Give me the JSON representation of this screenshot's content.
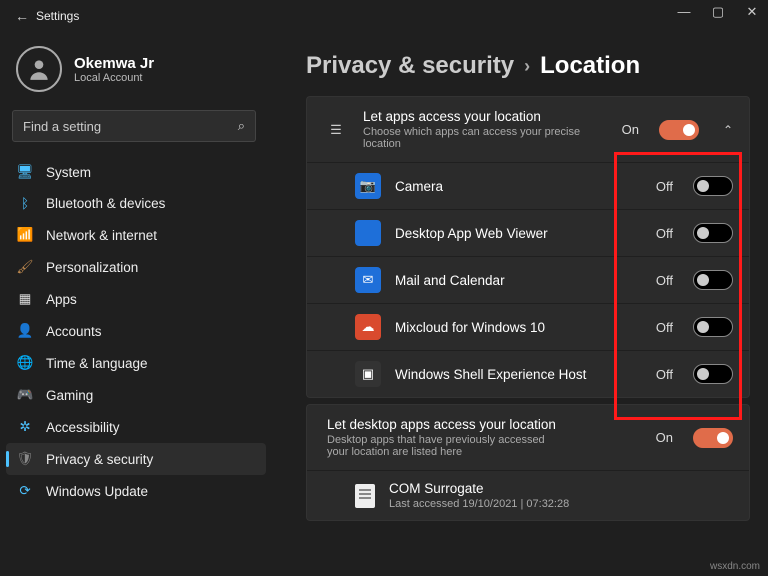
{
  "window": {
    "app_title": "Settings"
  },
  "profile": {
    "name": "Okemwa Jr",
    "account_type": "Local Account"
  },
  "search": {
    "placeholder": "Find a setting"
  },
  "nav": {
    "items": [
      {
        "label": "System",
        "icon_name": "system-icon",
        "color": "#4cc2ff",
        "glyph": "🖥"
      },
      {
        "label": "Bluetooth & devices",
        "icon_name": "bluetooth-icon",
        "color": "#4cc2ff",
        "glyph": "ᛒ"
      },
      {
        "label": "Network & internet",
        "icon_name": "network-icon",
        "color": "#4cc2ff",
        "glyph": "📶"
      },
      {
        "label": "Personalization",
        "icon_name": "personalization-icon",
        "color": "#c08a4f",
        "glyph": "🖌"
      },
      {
        "label": "Apps",
        "icon_name": "apps-icon",
        "color": "#ddd",
        "glyph": "▦"
      },
      {
        "label": "Accounts",
        "icon_name": "accounts-icon",
        "color": "#ddd",
        "glyph": "👤"
      },
      {
        "label": "Time & language",
        "icon_name": "time-icon",
        "color": "#4cc2ff",
        "glyph": "🌐"
      },
      {
        "label": "Gaming",
        "icon_name": "gaming-icon",
        "color": "#7fd06f",
        "glyph": "🎮"
      },
      {
        "label": "Accessibility",
        "icon_name": "accessibility-icon",
        "color": "#4cc2ff",
        "glyph": "✲"
      },
      {
        "label": "Privacy & security",
        "icon_name": "privacy-icon",
        "color": "#888",
        "glyph": "🛡",
        "selected": true
      },
      {
        "label": "Windows Update",
        "icon_name": "update-icon",
        "color": "#4cc2ff",
        "glyph": "⟳"
      }
    ]
  },
  "breadcrumb": {
    "parent": "Privacy & security",
    "current": "Location"
  },
  "master_toggle": {
    "title": "Let apps access your location",
    "subtitle": "Choose which apps can access your precise location",
    "state_label": "On",
    "on": true
  },
  "app_perms": [
    {
      "label": "Camera",
      "state_label": "Off",
      "on": false,
      "icon_bg": "#1e6fd9",
      "icon_name": "camera-app-icon",
      "glyph": "📷"
    },
    {
      "label": "Desktop App Web Viewer",
      "state_label": "Off",
      "on": false,
      "icon_bg": "#1e6fd9",
      "icon_name": "web-viewer-icon",
      "glyph": ""
    },
    {
      "label": "Mail and Calendar",
      "state_label": "Off",
      "on": false,
      "icon_bg": "#1e6fd9",
      "icon_name": "mail-icon",
      "glyph": "✉"
    },
    {
      "label": "Mixcloud for Windows 10",
      "state_label": "Off",
      "on": false,
      "icon_bg": "#d94a2e",
      "icon_name": "mixcloud-icon",
      "glyph": "☁"
    },
    {
      "label": "Windows Shell Experience Host",
      "state_label": "Off",
      "on": false,
      "icon_bg": "#333",
      "icon_name": "shell-host-icon",
      "glyph": "▣"
    }
  ],
  "desktop_section": {
    "title": "Let desktop apps access your location",
    "subtitle": "Desktop apps that have previously accessed your location are listed here",
    "state_label": "On",
    "on": true
  },
  "desktop_apps": [
    {
      "label": "COM Surrogate",
      "sub": "Last accessed 19/10/2021 | 07:32:28"
    }
  ],
  "watermark": "wsxdn.com"
}
